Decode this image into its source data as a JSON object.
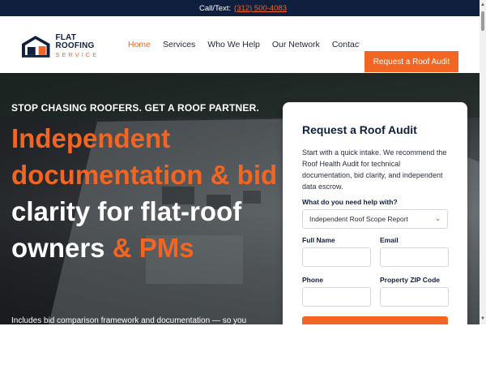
{
  "topbar": {
    "prefix": "Call/Text:",
    "phone": "(312) 500-4083"
  },
  "logo": {
    "main": "FLAT ROOFING",
    "sub": "SERVICE"
  },
  "nav": {
    "items": [
      {
        "label": "Home",
        "active": true
      },
      {
        "label": "Services"
      },
      {
        "label": "Who We Help"
      },
      {
        "label": "Our Network"
      },
      {
        "label": "Contact"
      }
    ],
    "cta": "Request a Roof Audit"
  },
  "hero": {
    "kicker": "STOP CHASING ROOFERS. GET A ROOF PARTNER.",
    "headline_part1": "Independent documentation &",
    "headline_part2": "bid",
    "headline_part3": " clarity for flat-roof owners",
    "headline_part4": "& PMs",
    "sub": "Includes bid comparison framework and documentation — so you"
  },
  "form": {
    "title": "Request a Roof Audit",
    "description": "Start with a quick intake. We recommend the Roof Health Audit for technical documentation, bid clarity, and independent data escrow.",
    "question": "What do you need help with?",
    "select_value": "Independent Roof Scope Report",
    "full_name_label": "Full Name",
    "email_label": "Email",
    "phone_label": "Phone",
    "zip_label": "Property ZIP Code"
  },
  "colors": {
    "accent": "#f26522",
    "navy": "#0f1f3d"
  }
}
